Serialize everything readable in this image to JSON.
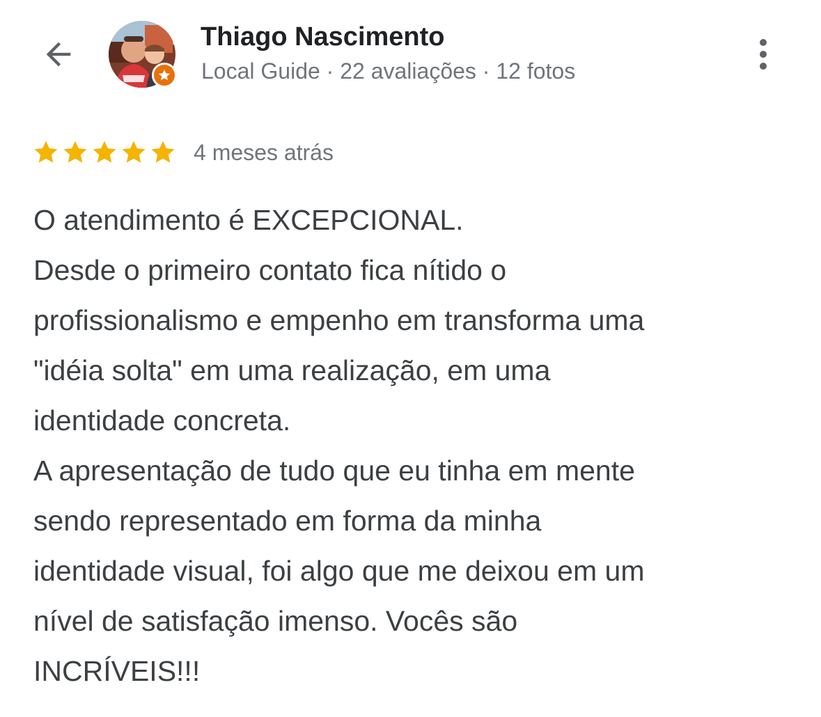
{
  "colors": {
    "star": "#f4b400",
    "badge": "#e8710a",
    "text": "#3c4043",
    "secondary": "#70757a"
  },
  "header": {
    "back_icon": "arrow-back-icon",
    "user_name": "Thiago Nascimento",
    "user_meta": "Local Guide · 22 avaliações · 12 fotos",
    "badge_icon": "local-guide-star-icon",
    "more_icon": "more-vertical-icon"
  },
  "review": {
    "rating": 5,
    "rating_max": 5,
    "time": "4 meses atrás",
    "lines": [
      "O atendimento é EXCEPCIONAL.",
      "Desde o primeiro contato fica nítido o",
      "profissionalismo e empenho em transforma uma",
      "\"idéia solta\" em uma realização, em uma",
      "identidade concreta.",
      "A apresentação de tudo que eu tinha em mente",
      "sendo representado em forma da minha",
      "identidade visual, foi algo que me deixou em um",
      "nível de satisfação imenso. Vocês são",
      "INCRÍVEIS!!!"
    ]
  }
}
